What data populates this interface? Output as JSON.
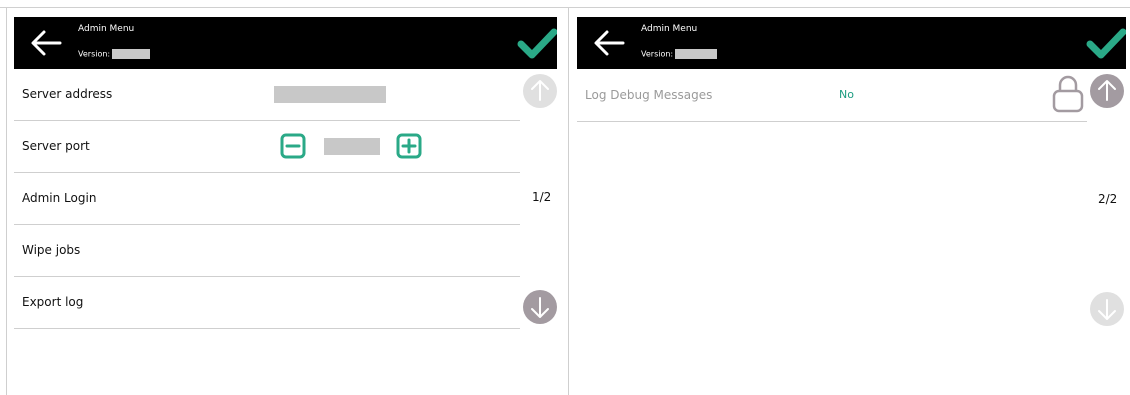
{
  "left_panel": {
    "header": {
      "title": "Admin Menu",
      "version_label": "Version:"
    },
    "rows": [
      {
        "label": "Server address"
      },
      {
        "label": "Server port"
      },
      {
        "label": "Admin Login"
      },
      {
        "label": "Wipe jobs"
      },
      {
        "label": "Export log"
      }
    ],
    "page_indicator": "1/2"
  },
  "right_panel": {
    "header": {
      "title": "Admin Menu",
      "version_label": "Version:"
    },
    "rows": [
      {
        "label": "Log Debug Messages",
        "value": "No"
      }
    ],
    "page_indicator": "2/2"
  },
  "colors": {
    "accent_green": "#2aa987",
    "header_bg": "#000000",
    "nav_enabled": "#a39ba1",
    "nav_disabled": "#e0e0e0"
  },
  "icons": [
    "back-arrow-icon",
    "checkmark-icon",
    "minus-icon",
    "plus-icon",
    "scroll-up-icon",
    "scroll-down-icon",
    "lock-icon"
  ]
}
